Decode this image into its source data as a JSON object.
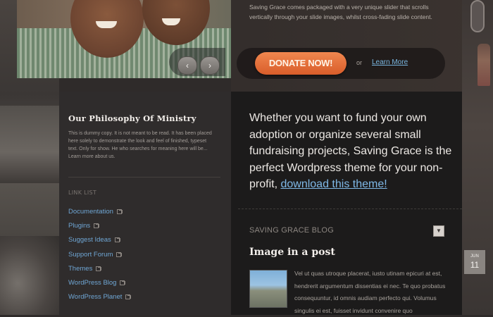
{
  "slider": {
    "description": "Saving Grace comes packaged with a very unique slider that scrolls vertically through your slide images, whilst cross-fading slide content.",
    "prev_label": "‹",
    "next_label": "›",
    "donate_label": "DONATE NOW!",
    "or_text": "or",
    "learn_more_label": "Learn More"
  },
  "philosophy": {
    "title": "Our Philosophy Of Ministry",
    "body": "This is dummy copy. It is not meant to be read. It has been placed here solely to demonstrate the look and feel of finished, typeset text. Only for show. He who searches for meaning here will be... Learn more about us."
  },
  "link_list": {
    "title": "LINK LIST",
    "items": [
      "Documentation",
      "Plugins",
      "Suggest Ideas",
      "Support Forum",
      "Themes",
      "WordPress Blog",
      "WordPress Planet"
    ]
  },
  "intro": {
    "text": "Whether you want to fund your own adoption or organize several small fundraising projects, Saving Grace is the perfect Wordpress theme for your non-profit, ",
    "link_text": "download this theme!"
  },
  "blog": {
    "title": "SAVING GRACE BLOG",
    "toggle_icon": "▼",
    "post_title": "Image in a post",
    "post_excerpt": "Vel ut quas utroque placerat, iusto utinam epicuri at est, hendrerit argumentum dissentias ei nec. Te quo probatus consequuntur, id omnis audiam perfecto qui. Volumus singulis ei est, fuisset invidunt convenire quo",
    "date_month": "JUN",
    "date_day": "11"
  },
  "colors": {
    "accent_orange": "#e0672f",
    "link_blue": "#6fa6d4"
  }
}
